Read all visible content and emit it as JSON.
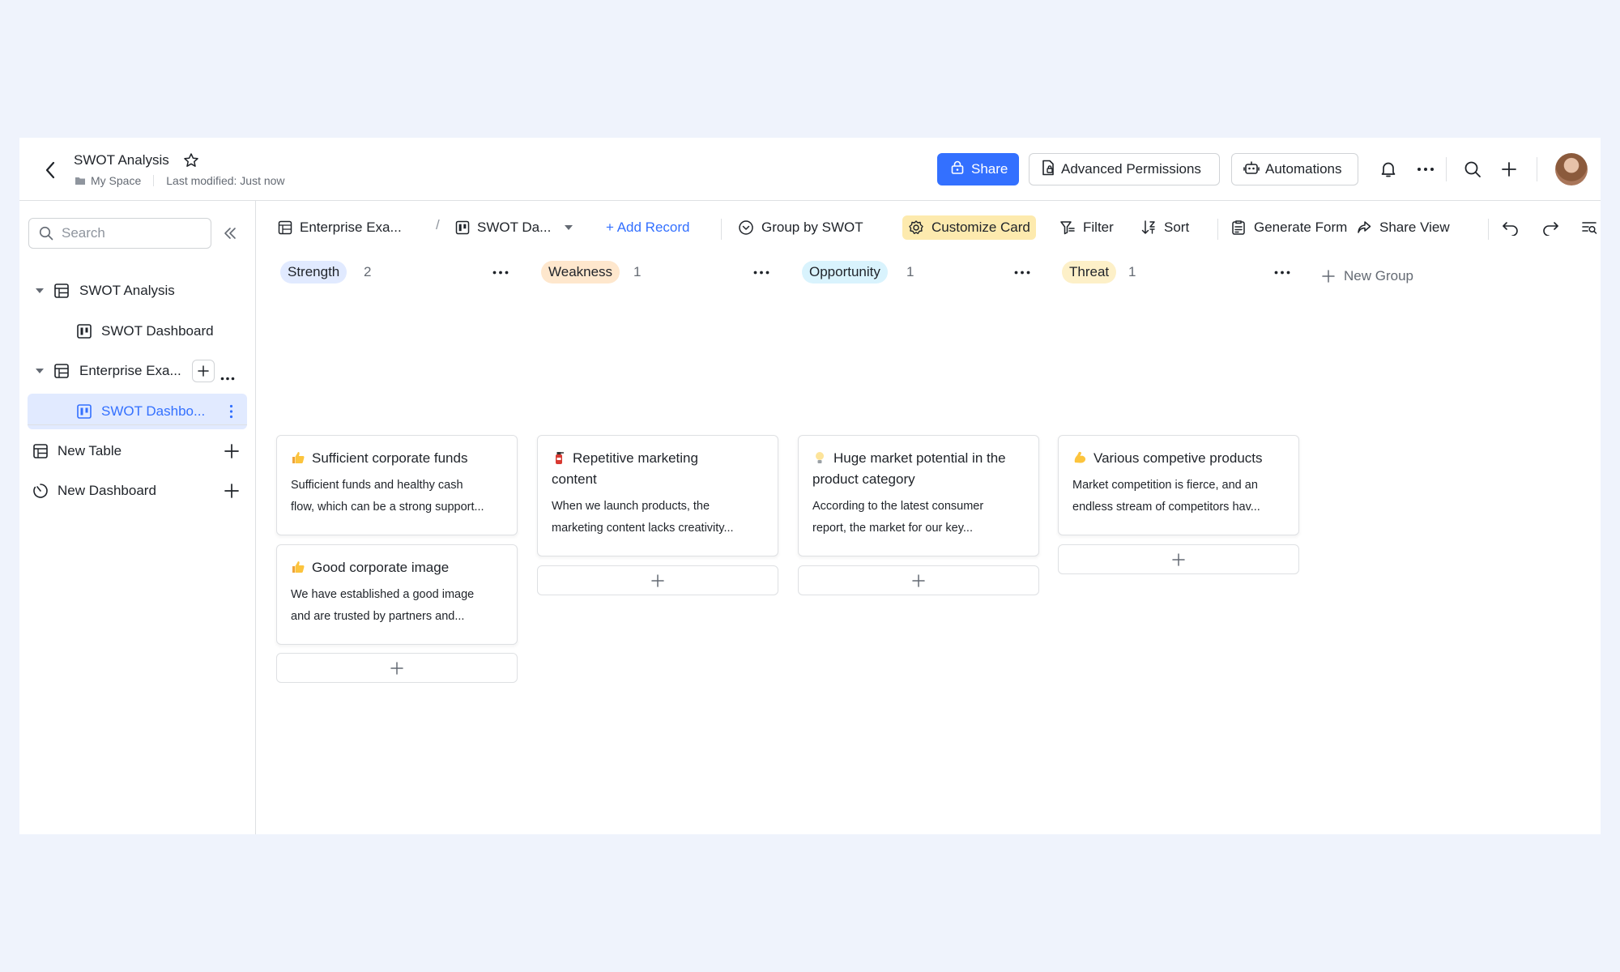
{
  "header": {
    "title": "SWOT Analysis",
    "location": "My Space",
    "last_modified": "Last modified: Just now",
    "share_label": "Share",
    "advanced_permissions_label": "Advanced Permissions",
    "automations_label": "Automations"
  },
  "sidebar": {
    "search_placeholder": "Search",
    "items": [
      {
        "label": "SWOT Analysis",
        "icon": "table-icon"
      },
      {
        "label": "SWOT Dashboard",
        "icon": "kanban-icon"
      },
      {
        "label": "Enterprise Exa...",
        "icon": "table-icon"
      },
      {
        "label": "SWOT Dashbo...",
        "icon": "kanban-icon",
        "active": true
      }
    ],
    "new_table_label": "New Table",
    "new_dashboard_label": "New Dashboard"
  },
  "toolbar": {
    "table_crumb": "Enterprise Exa...",
    "view_crumb": "SWOT Da...",
    "add_record": "+ Add Record",
    "group_by": "Group by SWOT",
    "customize_card": "Customize Card",
    "filter": "Filter",
    "sort": "Sort",
    "generate_form": "Generate Form",
    "share_view": "Share View"
  },
  "board": {
    "new_group_label": "New Group",
    "groups": [
      {
        "name": "Strength",
        "count": "2",
        "color": "#e1eaff",
        "cards": [
          {
            "emoji": "thumbs-up-icon",
            "title": "Sufficient corporate funds",
            "desc_line1": "Sufficient funds and healthy cash",
            "desc_line2": "flow, which can be a strong support..."
          },
          {
            "emoji": "thumbs-up-icon",
            "title": "Good corporate image",
            "desc_line1": "We have established a good image",
            "desc_line2": "and are trusted by partners and..."
          }
        ]
      },
      {
        "name": "Weakness",
        "count": "1",
        "color": "#fee7cd",
        "cards": [
          {
            "emoji": "fire-extinguisher-icon",
            "title_line1": "Repetitive marketing",
            "title_line2": "content",
            "desc_line1": "When we launch products, the",
            "desc_line2": "marketing content lacks creativity..."
          }
        ]
      },
      {
        "name": "Opportunity",
        "count": "1",
        "color": "#d9f3fd",
        "cards": [
          {
            "emoji": "light-bulb-icon",
            "title_line1": "Huge market potential in the",
            "title_line2": "product category",
            "desc_line1": "According to the latest consumer",
            "desc_line2": "report, the market for our key..."
          }
        ]
      },
      {
        "name": "Threat",
        "count": "1",
        "color": "#fdf0c8",
        "cards": [
          {
            "emoji": "flexed-biceps-icon",
            "title": "Various competive products",
            "desc_line1": "Market competition is fierce, and an",
            "desc_line2": "endless stream of competitors hav..."
          }
        ]
      }
    ]
  },
  "colors": {
    "accent": "#3370ff",
    "highlight": "#fdeaae",
    "border": "#dee0e3"
  }
}
